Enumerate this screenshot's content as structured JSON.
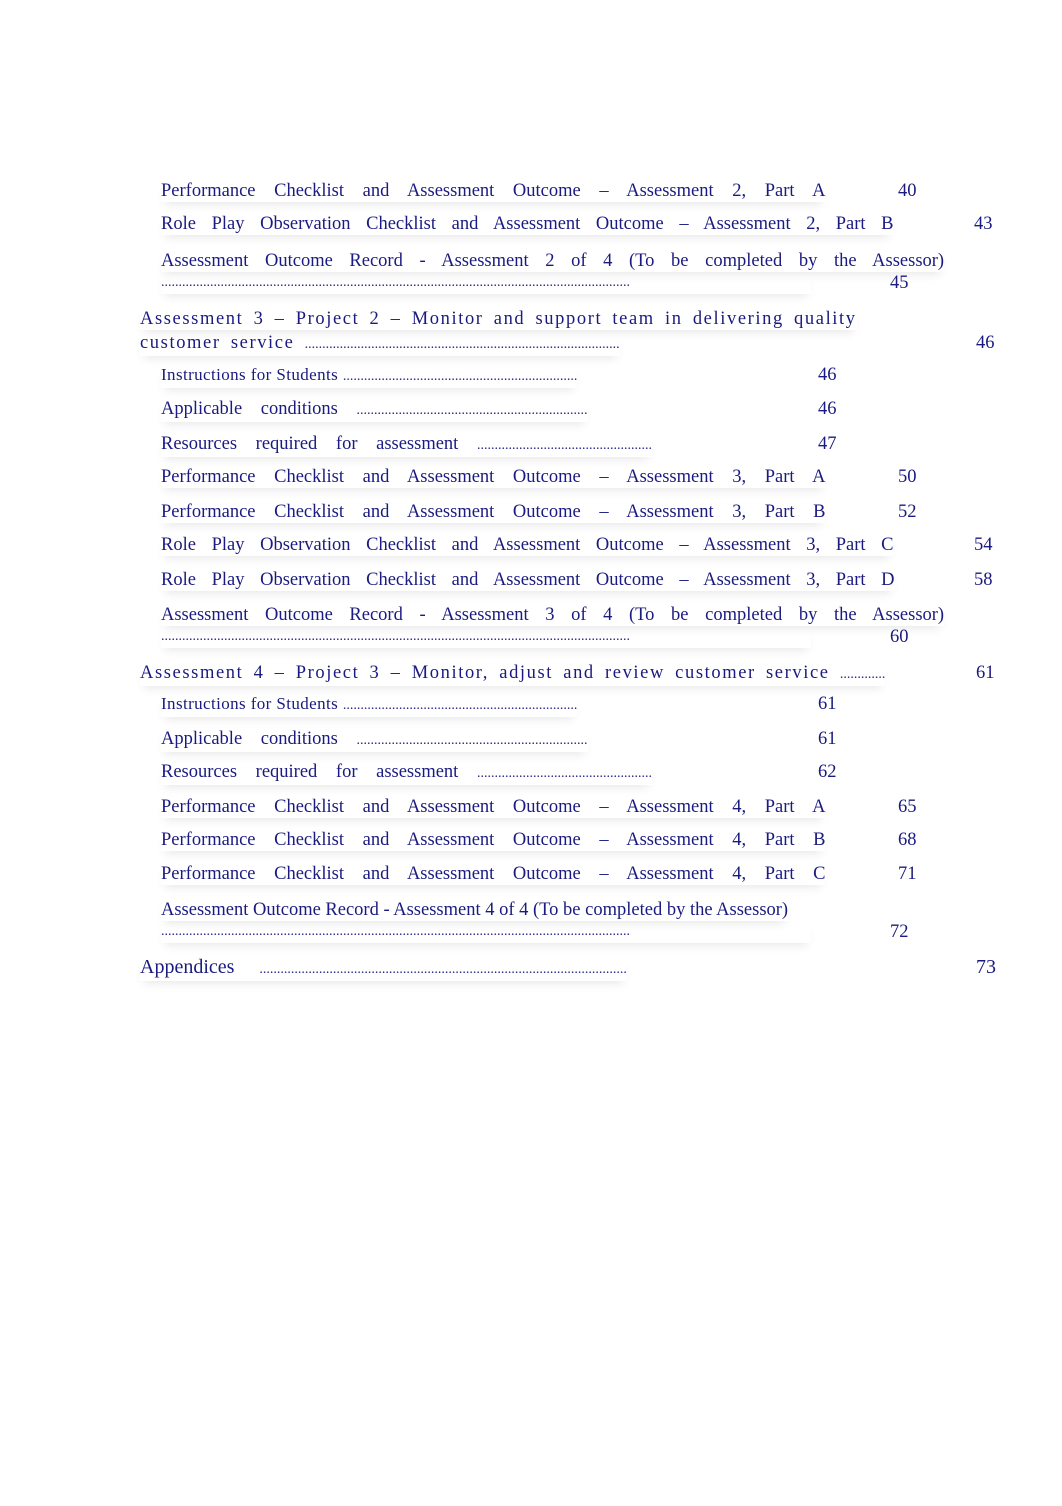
{
  "toc": {
    "entries": [
      {
        "text": "Performance Checklist and Assessment Outcome – Assessment 2, Part A",
        "page": "40"
      },
      {
        "text": "Role Play Observation Checklist and Assessment Outcome – Assessment 2, Part B",
        "page": "43"
      },
      {
        "text": "Assessment Outcome Record - Assessment 2 of 4 (To be completed by the Assessor)",
        "dots": "......................................................................................................................................",
        "page": "45"
      },
      {
        "text": "Assessment 3 – Project 2 – Monitor and support team in delivering quality",
        "text2": "customer service",
        "dots": "..........................................................................................",
        "page": "46"
      },
      {
        "text": "Instructions for Students",
        "dots": "...................................................................",
        "page": "46"
      },
      {
        "text": "Applicable conditions",
        "dots": "..................................................................",
        "page": "46"
      },
      {
        "text": "Resources required for assessment",
        "dots": "..................................................",
        "page": "47"
      },
      {
        "text": "Performance Checklist and Assessment Outcome – Assessment 3, Part A",
        "page": "50"
      },
      {
        "text": "Performance Checklist and Assessment Outcome – Assessment 3, Part B",
        "page": "52"
      },
      {
        "text": "Role Play Observation Checklist and Assessment Outcome – Assessment 3, Part C",
        "page": "54"
      },
      {
        "text": "Role Play Observation Checklist and Assessment Outcome – Assessment 3, Part D",
        "page": "58"
      },
      {
        "text": "Assessment Outcome Record - Assessment 3 of 4 (To be completed by the Assessor)",
        "dots": "......................................................................................................................................",
        "page": "60"
      },
      {
        "text": "Assessment 4 – Project 3 – Monitor, adjust and review customer service",
        "dots": ".............",
        "page": "61"
      },
      {
        "text": "Instructions for Students",
        "dots": "...................................................................",
        "page": "61"
      },
      {
        "text": "Applicable conditions",
        "dots": "..................................................................",
        "page": "61"
      },
      {
        "text": "Resources required for assessment",
        "dots": "..................................................",
        "page": "62"
      },
      {
        "text": "Performance Checklist and Assessment Outcome – Assessment 4, Part A",
        "page": "65"
      },
      {
        "text": "Performance Checklist and Assessment Outcome – Assessment 4, Part B",
        "page": "68"
      },
      {
        "text": "Performance Checklist and Assessment Outcome – Assessment 4, Part C",
        "page": "71"
      },
      {
        "text": "Assessment Outcome Record - Assessment 4 of 4 (To be completed by the Assessor)",
        "dots": "......................................................................................................................................",
        "page": "72"
      },
      {
        "text": "Appendices",
        "dots": ".........................................................................................................",
        "page": "73"
      }
    ]
  },
  "colors": {
    "text": "#1a1a80"
  }
}
